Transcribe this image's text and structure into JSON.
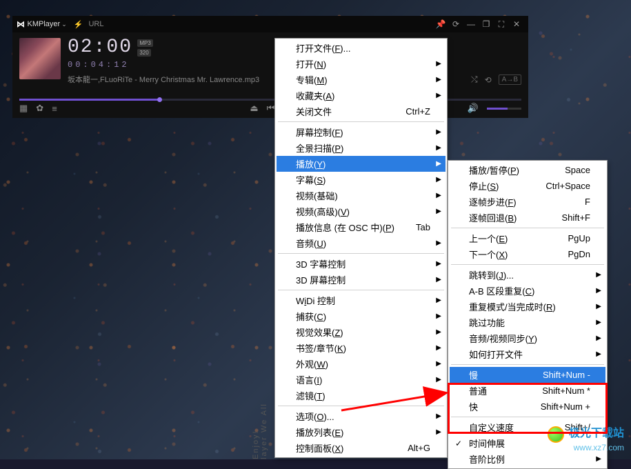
{
  "app": {
    "name": "KMPlayer",
    "url_label": "URL"
  },
  "player": {
    "big_time": "02:00",
    "badge1": "MP3",
    "badge2": "320",
    "sub_time": "00:04:12",
    "track": "坂本龍一,FLuoRiTe - Merry Christmas Mr. Lawrence.mp3",
    "ab_label": "A→B"
  },
  "side_text": "layer We All Enjoy!",
  "main_menu": [
    {
      "type": "item",
      "label": "打开文件(",
      "u": "F",
      "after": ")...",
      "arrow": false
    },
    {
      "type": "item",
      "label": "打开(",
      "u": "N",
      "after": ")",
      "arrow": true
    },
    {
      "type": "item",
      "label": "专辑(",
      "u": "M",
      "after": ")",
      "arrow": true
    },
    {
      "type": "item",
      "label": "收藏夹(",
      "u": "A",
      "after": ")",
      "arrow": true
    },
    {
      "type": "item",
      "label": "关闭文件",
      "shortcut": "Ctrl+Z"
    },
    {
      "type": "sep"
    },
    {
      "type": "item",
      "label": "屏幕控制(",
      "u": "F",
      "after": ")",
      "arrow": true
    },
    {
      "type": "item",
      "label": "全景扫描(",
      "u": "P",
      "after": ")",
      "arrow": true
    },
    {
      "type": "item",
      "label": "播放(",
      "u": "Y",
      "after": ")",
      "arrow": true,
      "highlight": true
    },
    {
      "type": "item",
      "label": "字幕(",
      "u": "S",
      "after": ")",
      "arrow": true
    },
    {
      "type": "item",
      "label": "视频(基础)",
      "arrow": true
    },
    {
      "type": "item",
      "label": "视频(高级)(",
      "u": "V",
      "after": ")",
      "arrow": true
    },
    {
      "type": "item",
      "label": "播放信息 (在 OSC 中)(",
      "u": "P",
      "after": ")",
      "shortcut": "Tab"
    },
    {
      "type": "item",
      "label": "音频(",
      "u": "U",
      "after": ")",
      "arrow": true
    },
    {
      "type": "sep"
    },
    {
      "type": "item",
      "label": "3D 字幕控制",
      "arrow": true
    },
    {
      "type": "item",
      "label": "3D 屏幕控制",
      "arrow": true
    },
    {
      "type": "sep"
    },
    {
      "type": "item",
      "label": "W",
      "u": "i",
      "after": "Di 控制",
      "arrow": true,
      "pre_u": true
    },
    {
      "type": "item",
      "label": "捕获(",
      "u": "C",
      "after": ")",
      "arrow": true
    },
    {
      "type": "item",
      "label": "视觉效果(",
      "u": "Z",
      "after": ")",
      "arrow": true
    },
    {
      "type": "item",
      "label": "书签/章节(",
      "u": "K",
      "after": ")",
      "arrow": true
    },
    {
      "type": "item",
      "label": "外观(",
      "u": "W",
      "after": ")",
      "arrow": true
    },
    {
      "type": "item",
      "label": "语言(",
      "u": "I",
      "after": ")",
      "arrow": true
    },
    {
      "type": "item",
      "label": "滤镜(",
      "u": "T",
      "after": ")",
      "arrow": true
    },
    {
      "type": "sep"
    },
    {
      "type": "item",
      "label": "选项(",
      "u": "O",
      "after": ")...",
      "arrow": true
    },
    {
      "type": "item",
      "label": "播放列表(",
      "u": "E",
      "after": ")",
      "arrow": true
    },
    {
      "type": "item",
      "label": "控制面板(",
      "u": "X",
      "after": ")",
      "shortcut": "Alt+G"
    }
  ],
  "sub_menu": [
    {
      "type": "item",
      "label": "播放/暂停(",
      "u": "P",
      "after": ")",
      "shortcut": "Space"
    },
    {
      "type": "item",
      "label": "停止(",
      "u": "S",
      "after": ")",
      "shortcut": "Ctrl+Space"
    },
    {
      "type": "item",
      "label": "逐帧步进(",
      "u": "F",
      "after": ")",
      "shortcut": "F"
    },
    {
      "type": "item",
      "label": "逐帧回退(",
      "u": "B",
      "after": ")",
      "shortcut": "Shift+F"
    },
    {
      "type": "sep"
    },
    {
      "type": "item",
      "label": "上一个(",
      "u": "E",
      "after": ")",
      "shortcut": "PgUp"
    },
    {
      "type": "item",
      "label": "下一个(",
      "u": "X",
      "after": ")",
      "shortcut": "PgDn"
    },
    {
      "type": "sep"
    },
    {
      "type": "item",
      "label": "跳转到(",
      "u": "J",
      "after": ")...",
      "arrow": true
    },
    {
      "type": "item",
      "label": "A-B 区段重复(",
      "u": "C",
      "after": ")",
      "arrow": true
    },
    {
      "type": "item",
      "label": "重复模式/当完成时(",
      "u": "R",
      "after": ")",
      "arrow": true
    },
    {
      "type": "item",
      "label": "跳过功能",
      "arrow": true
    },
    {
      "type": "item",
      "label": "音频/视频同步(",
      "u": "Y",
      "after": ")",
      "arrow": true
    },
    {
      "type": "item",
      "label": "如何打开文件",
      "arrow": true
    },
    {
      "type": "sep"
    },
    {
      "type": "item",
      "label": "慢",
      "shortcut": "Shift+Num -",
      "highlight": true
    },
    {
      "type": "item",
      "label": "普通",
      "shortcut": "Shift+Num *"
    },
    {
      "type": "item",
      "label": "快",
      "shortcut": "Shift+Num +"
    },
    {
      "type": "sep"
    },
    {
      "type": "item",
      "label": "自定义速度",
      "shortcut": "Shift+/"
    },
    {
      "type": "item",
      "label": "时间伸展",
      "check": true
    },
    {
      "type": "item",
      "label": "音阶比例",
      "arrow": true
    }
  ],
  "watermark": {
    "name": "极光下载站",
    "url": "www.xz7.com"
  }
}
